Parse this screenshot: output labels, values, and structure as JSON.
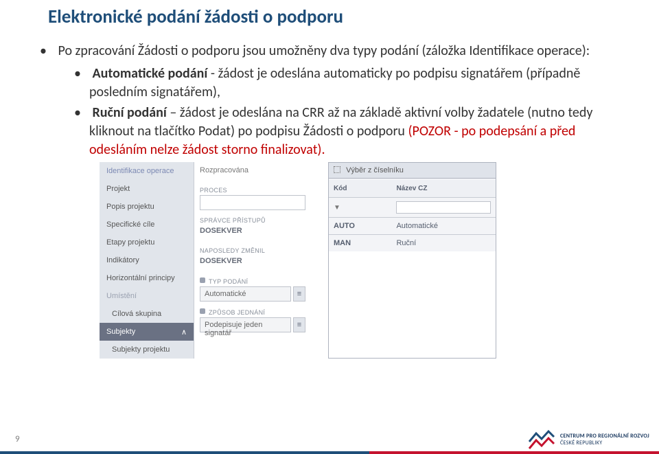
{
  "title": "Elektronické podání žádosti o podporu",
  "p1_a": "Po zpracování Žádosti o podporu jsou umožněny dva typy podání (záložka Identifikace operace):",
  "p2_prefix": "Automatické podání",
  "p2_rest": "  - žádost je odeslána automaticky po podpisu signatářem (případně posledním signatářem),",
  "p3_prefix": "Ruční podání",
  "p3_rest": " – žádost je odeslána na CRR až na základě aktivní volby žadatele (nutno tedy kliknout na tlačítko Podat) po podpisu Žádosti o podporu ",
  "p3_red": "(POZOR - po podepsání a před odesláním nelze žádost storno finalizovat).",
  "sidebar": {
    "items": [
      "Identifikace operace",
      "Projekt",
      "Popis projektu",
      "Specifické cíle",
      "Etapy projektu",
      "Indikátory",
      "Horizontální principy",
      "Umístění",
      "Cílová skupina",
      "Subjekty",
      "Subjekty projektu"
    ]
  },
  "mid": {
    "status": "Rozpracována",
    "proces_lbl": "PROCES",
    "spravce_lbl": "SPRÁVCE PŘÍSTUPŮ",
    "spravce_val": "DOSEKVER",
    "zmenil_lbl": "NAPOSLEDY ZMĚNIL",
    "zmenil_val": "DOSEKVER",
    "typ_lbl": "TYP PODÁNÍ",
    "typ_val": "Automatické",
    "zpusob_lbl": "ZPŮSOB JEDNÁNÍ",
    "zpusob_val": "Podepisuje jeden signatář"
  },
  "cisel": {
    "head": "Výběr z číselníku",
    "col_kod": "Kód",
    "col_naz": "Název CZ",
    "rows": [
      {
        "kod": "AUTO",
        "naz": "Automatické"
      },
      {
        "kod": "MAN",
        "naz": "Ruční"
      }
    ]
  },
  "page": "9",
  "logo": {
    "line1": "CENTRUM PRO REGIONÁLNÍ ROZVOJ",
    "line2": "ČESKÉ REPUBLIKY"
  }
}
